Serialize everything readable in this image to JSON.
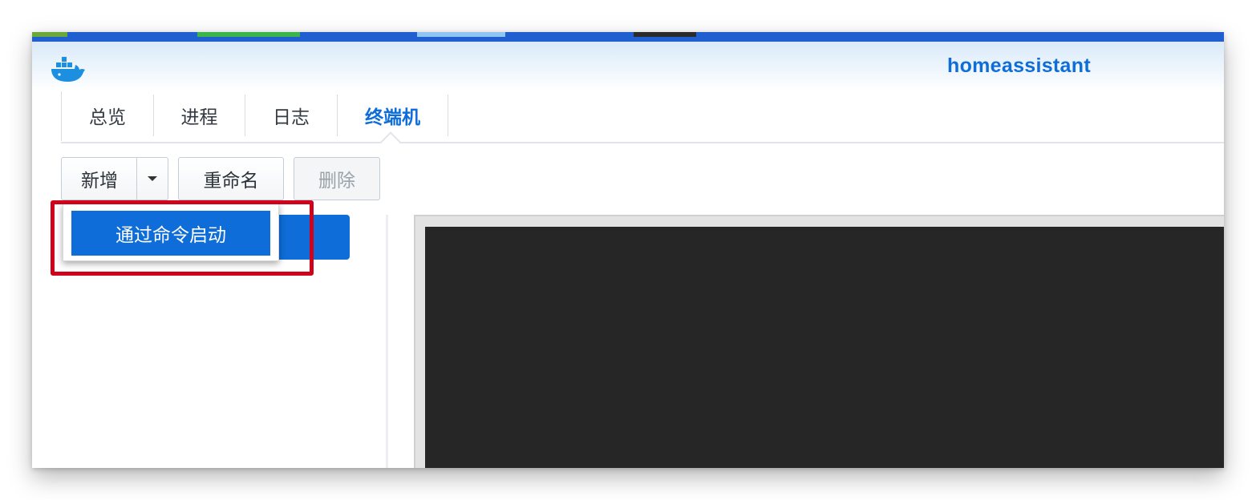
{
  "window": {
    "title": "homeassistant",
    "app_icon": "docker-whale-icon"
  },
  "tabs": [
    {
      "label": "总览",
      "active": false
    },
    {
      "label": "进程",
      "active": false
    },
    {
      "label": "日志",
      "active": false
    },
    {
      "label": "终端机",
      "active": true
    }
  ],
  "toolbar": {
    "add_label": "新增",
    "rename_label": "重命名",
    "delete_label": "删除",
    "delete_disabled": true
  },
  "dropdown": {
    "items": [
      {
        "label": "通过命令启动"
      }
    ]
  },
  "colors": {
    "accent": "#0e6dd8",
    "highlight": "#d0021b",
    "terminal_bg": "#262626"
  }
}
